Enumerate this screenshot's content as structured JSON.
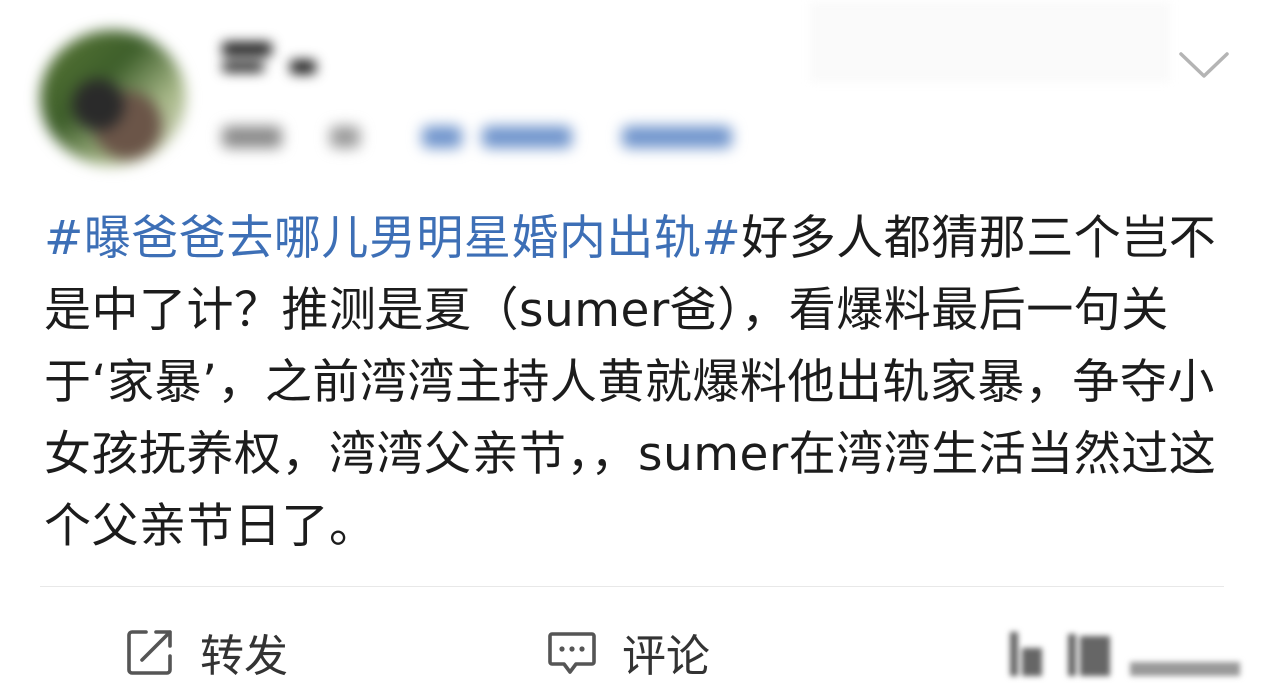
{
  "post": {
    "topic": "#曝爸爸去哪儿男明星婚内出轨#",
    "text": "好多人都猜那三个岂不是中了计？推测是夏（sumer爸），看爆料最后一句关于‘家暴’，之前湾湾主持人黄就爆料他出轨家暴，争夺小女孩抚养权，湾湾父亲节，，sumer在湾湾生活当然过这个父亲节日了。"
  },
  "actions": {
    "repost_label": "转发",
    "comment_label": "评论"
  },
  "icons": {
    "more": "chevron-down-icon",
    "repost": "repost-icon",
    "comment": "comment-icon",
    "like": "thumbs-up-icon"
  },
  "colors": {
    "topic_link": "#3d6fb6",
    "text": "#1c1c1c",
    "action_text": "#333333"
  }
}
